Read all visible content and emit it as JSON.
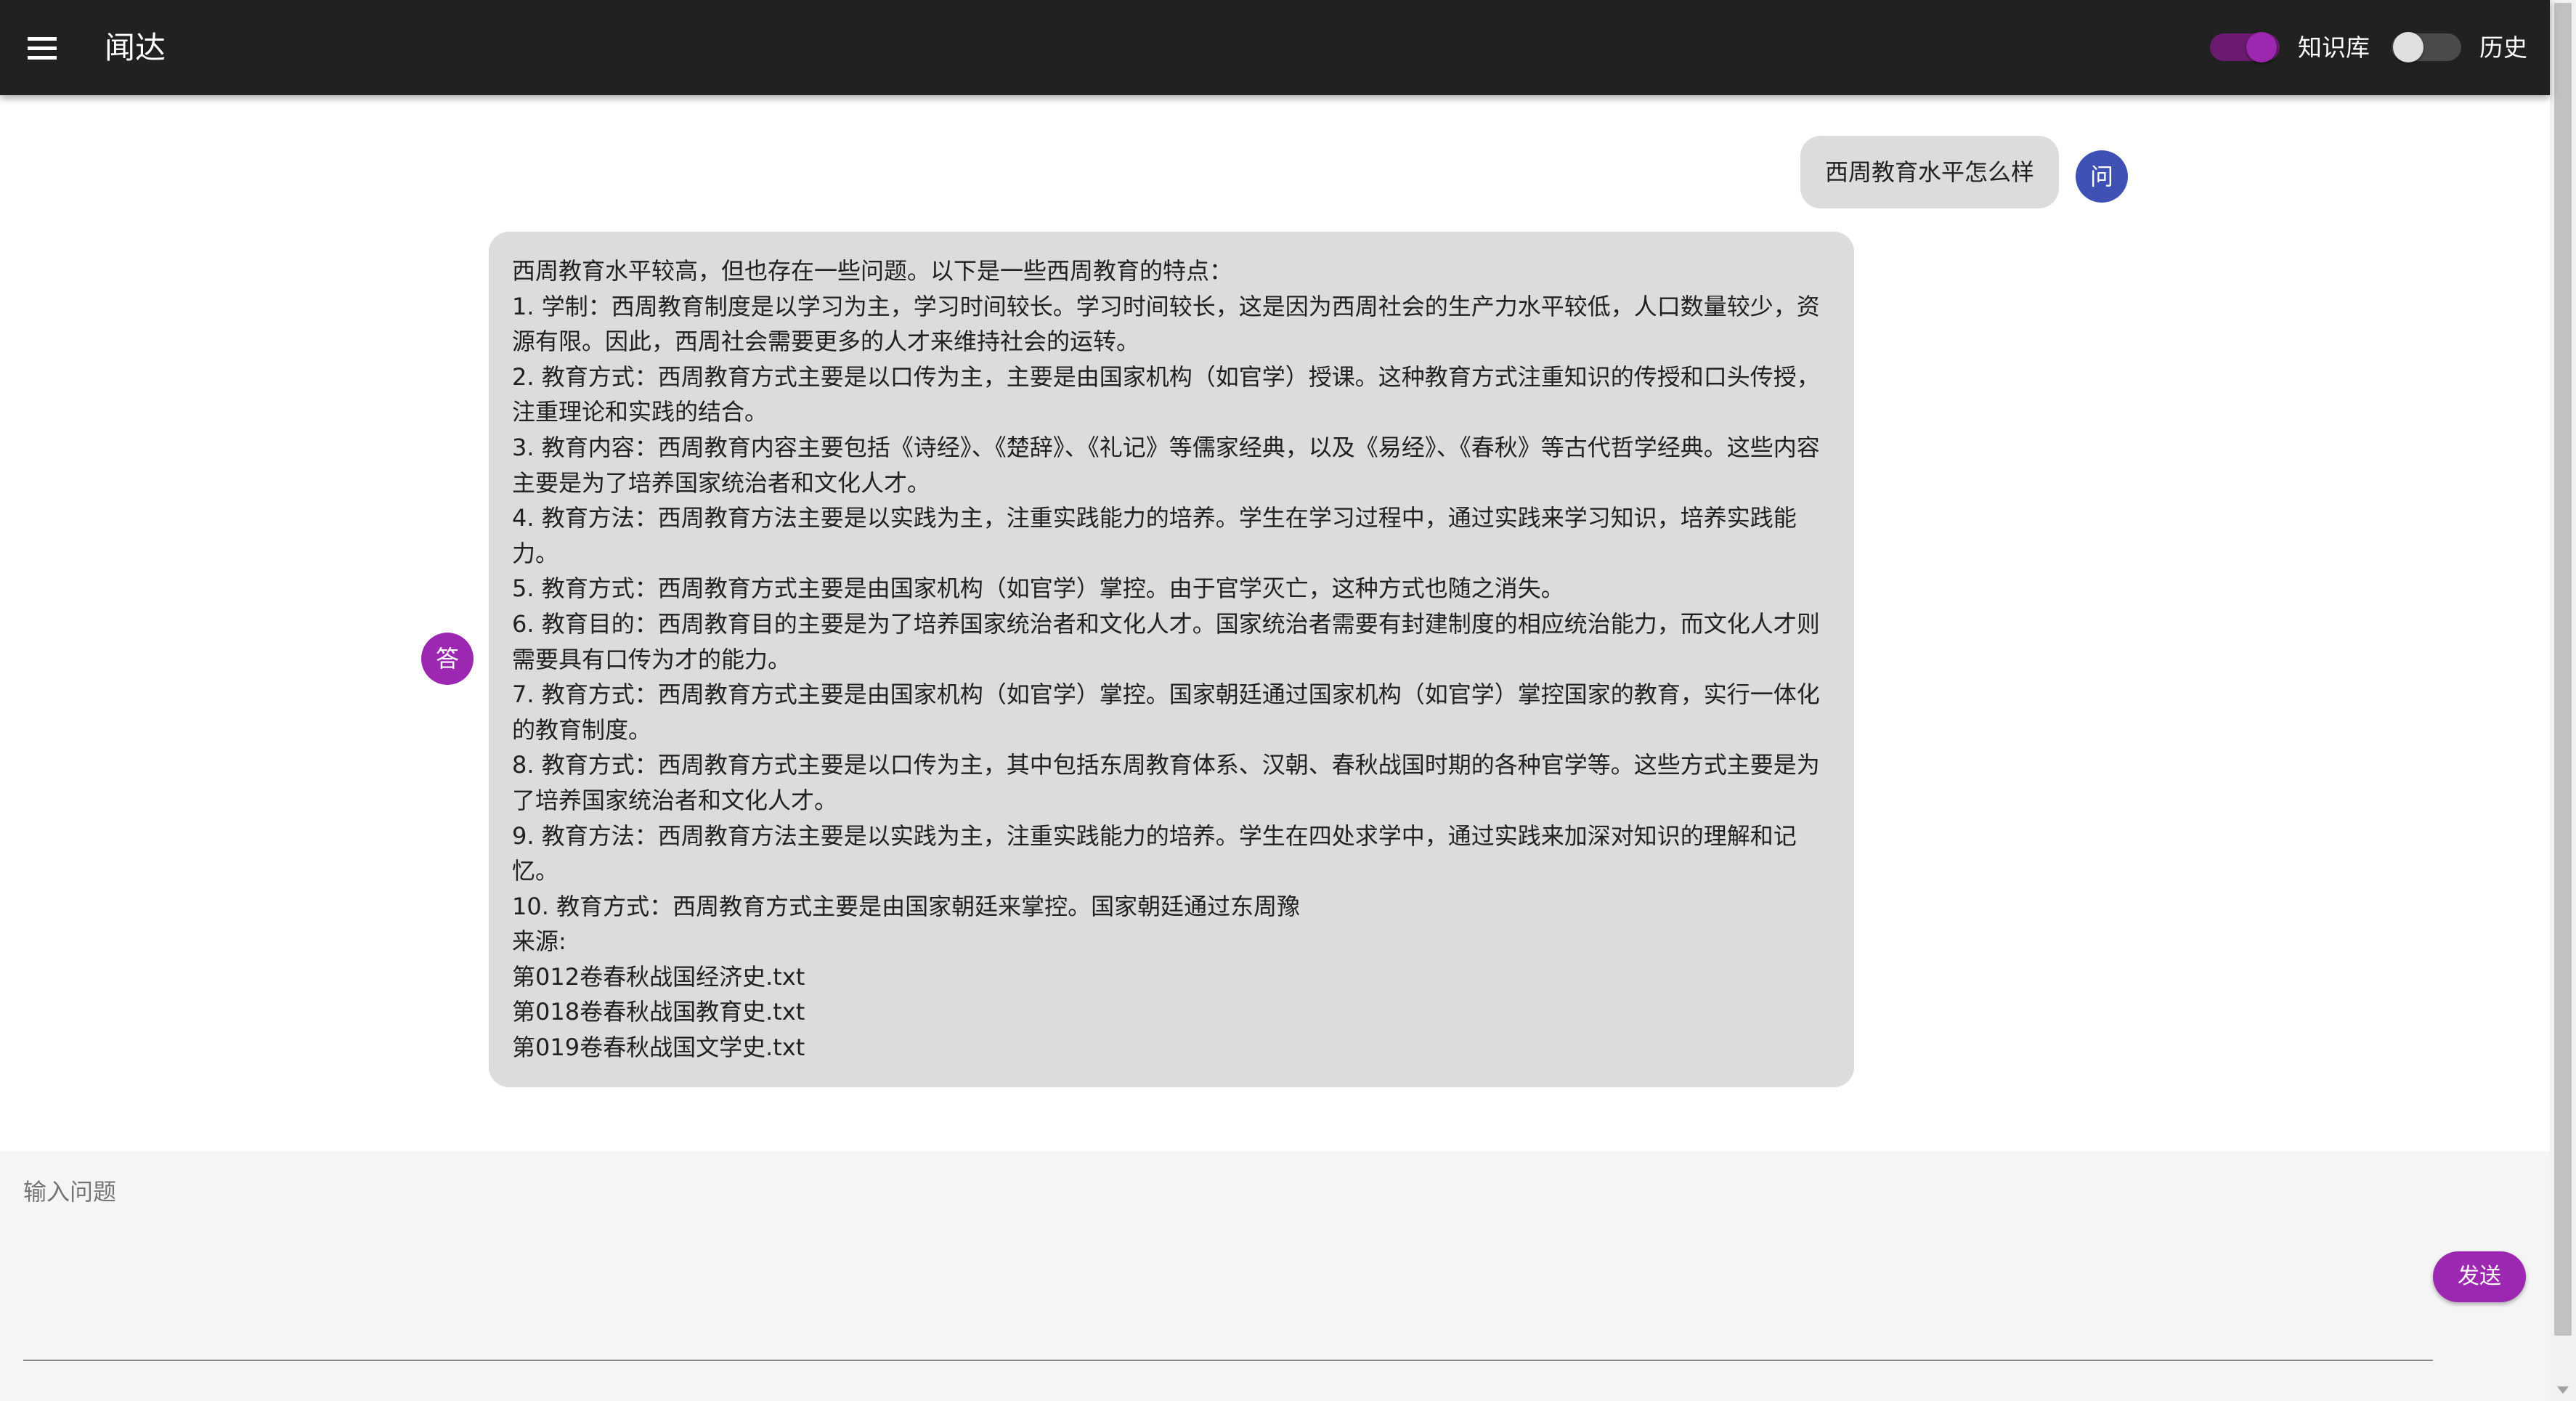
{
  "header": {
    "menu_icon": "menu-icon",
    "title": "闻达",
    "toggles": [
      {
        "label": "知识库",
        "on": true
      },
      {
        "label": "历史",
        "on": false
      }
    ]
  },
  "chat": {
    "question": {
      "avatar": "问",
      "text": "西周教育水平怎么样"
    },
    "answer": {
      "avatar": "答",
      "lines": [
        "西周教育水平较高，但也存在一些问题。以下是一些西周教育的特点：",
        "1. 学制：西周教育制度是以学习为主，学习时间较长。学习时间较长，这是因为西周社会的生产力水平较低，人口数量较少，资源有限。因此，西周社会需要更多的人才来维持社会的运转。",
        "2. 教育方式：西周教育方式主要是以口传为主，主要是由国家机构（如官学）授课。这种教育方式注重知识的传授和口头传授，注重理论和实践的结合。",
        "3. 教育内容：西周教育内容主要包括《诗经》、《楚辞》、《礼记》等儒家经典，以及《易经》、《春秋》等古代哲学经典。这些内容主要是为了培养国家统治者和文化人才。",
        "4. 教育方法：西周教育方法主要是以实践为主，注重实践能力的培养。学生在学习过程中，通过实践来学习知识，培养实践能力。",
        "5. 教育方式：西周教育方式主要是由国家机构（如官学）掌控。由于官学灭亡，这种方式也随之消失。",
        "6. 教育目的：西周教育目的主要是为了培养国家统治者和文化人才。国家统治者需要有封建制度的相应统治能力，而文化人才则需要具有口传为才的能力。",
        "7. 教育方式：西周教育方式主要是由国家机构（如官学）掌控。国家朝廷通过国家机构（如官学）掌控国家的教育，实行一体化的教育制度。",
        "8. 教育方式：西周教育方式主要是以口传为主，其中包括东周教育体系、汉朝、春秋战国时期的各种官学等。这些方式主要是为了培养国家统治者和文化人才。",
        "9. 教育方法：西周教育方法主要是以实践为主，注重实践能力的培养。学生在四处求学中，通过实践来加深对知识的理解和记忆。",
        "10. 教育方式：西周教育方式主要是由国家朝廷来掌控。国家朝廷通过东周豫",
        "来源:",
        "第012卷春秋战国经济史.txt",
        "第018卷春秋战国教育史.txt",
        "第019卷春秋战国文学史.txt"
      ]
    }
  },
  "input": {
    "placeholder": "输入问题",
    "send_label": "发送"
  },
  "colors": {
    "topbar": "#212121",
    "accent": "#9c27b0",
    "question_avatar": "#3f51b5",
    "bubble": "#dcdcdc"
  }
}
